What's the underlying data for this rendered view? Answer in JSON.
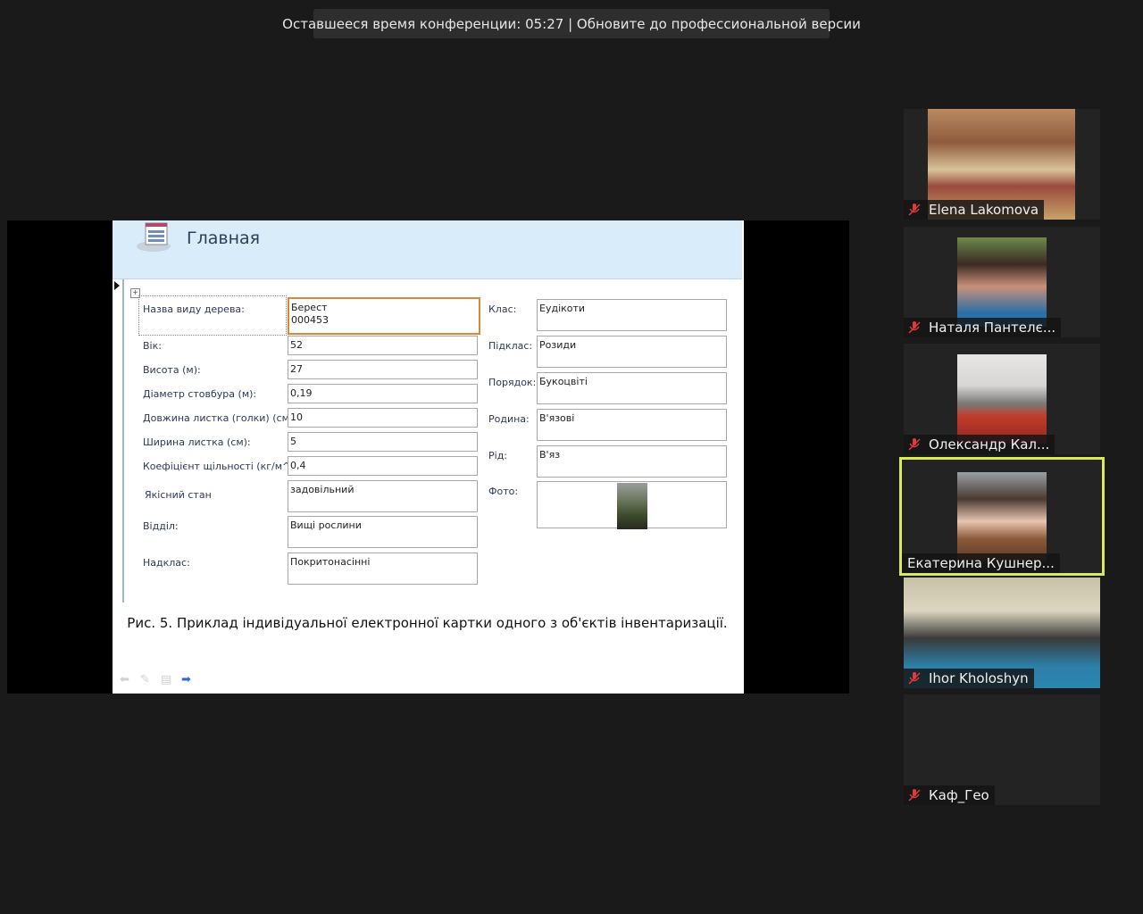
{
  "banner": {
    "text": "Оставшееся время конференции: 05:27 | Обновите до профессиональной версии"
  },
  "slide": {
    "form_title": "Главная",
    "fields_left": [
      {
        "label": "Назва виду дерева:",
        "value_line1": "Берест",
        "value_line2": "000453"
      },
      {
        "label": "Вік:",
        "value": "52"
      },
      {
        "label": "Висота (м):",
        "value": "27"
      },
      {
        "label": "Діаметр стовбура (м):",
        "value": " 0,19"
      },
      {
        "label": "Довжина листка (голки) (см):",
        "value": "10"
      },
      {
        "label": "Ширина листка (см):",
        "value": "5"
      },
      {
        "label": "Коефіцієнт щільності (кг/м^3):",
        "value": "0,4"
      },
      {
        "label": "Якісний стан",
        "value": "задовільний"
      },
      {
        "label": "Відділ:",
        "value": "Вищі рослини"
      },
      {
        "label": "Надклас:",
        "value": "Покритонасінні"
      }
    ],
    "fields_right": [
      {
        "label": "Клас:",
        "value": "Еудікоти"
      },
      {
        "label": "Підклас:",
        "value": "Розиди"
      },
      {
        "label": "Порядок:",
        "value": "Букоцвіті"
      },
      {
        "label": "Родина:",
        "value": "В'язові"
      },
      {
        "label": "Рід:",
        "value": "В'яз"
      },
      {
        "label": "Фото:",
        "value": ""
      }
    ],
    "caption": "Рис. 5. Приклад індивідуальної електронної картки одного з об'єктів інвентаризації.",
    "nav_icons": [
      "back-arrow-icon",
      "pen-icon",
      "menu-icon",
      "forward-arrow-icon"
    ]
  },
  "participants": [
    {
      "name": "Elena Lakomova",
      "muted": true,
      "active": false
    },
    {
      "name": "Наталя Пантелє...",
      "muted": true,
      "active": false
    },
    {
      "name": "Олександр Кал...",
      "muted": true,
      "active": false
    },
    {
      "name": "Екатерина Кушнер...",
      "muted": false,
      "active": true
    },
    {
      "name": "Ihor Kholoshyn",
      "muted": true,
      "active": false
    },
    {
      "name": "Каф_Гео",
      "muted": true,
      "active": false
    }
  ],
  "colors": {
    "active_speaker_border": "#d8ea5a",
    "mic_muted": "#e0393e"
  }
}
